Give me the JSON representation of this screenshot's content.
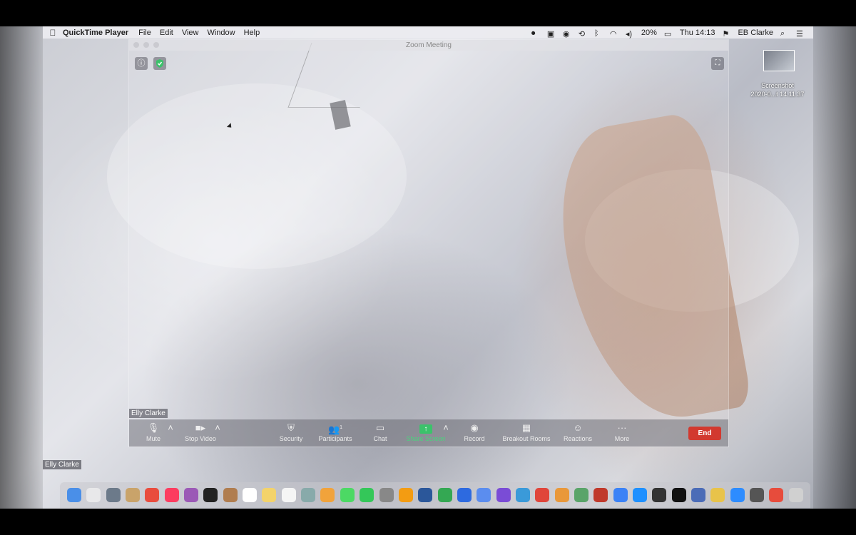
{
  "menubar": {
    "app_name": "QuickTime Player",
    "menus": [
      "File",
      "Edit",
      "View",
      "Window",
      "Help"
    ],
    "battery": "20%",
    "clock": "Thu 14:13",
    "user": "EB Clarke"
  },
  "zoom": {
    "window_title": "Zoom Meeting",
    "participant_name": "Elly Clarke",
    "participants_count": "1",
    "toolbar": {
      "mute": "Mute",
      "stop_video": "Stop Video",
      "security": "Security",
      "participants": "Participants",
      "chat": "Chat",
      "share_screen": "Share Screen",
      "record": "Record",
      "breakout_rooms": "Breakout Rooms",
      "reactions": "Reactions",
      "more": "More",
      "end": "End"
    }
  },
  "desktop": {
    "file_label_line1": "Screenshot",
    "file_label_line2": "2020-0...t 14.11.37",
    "bottom_name": "Elly Clarke"
  },
  "colors": {
    "end_button": "#d2392f",
    "share_green": "#4bd27e"
  },
  "dock_icons": [
    "finder",
    "safari",
    "launchpad",
    "notes",
    "chrome",
    "music",
    "podcasts",
    "tv",
    "contacts",
    "calendar",
    "stickies",
    "reminders",
    "photos-preview",
    "photos",
    "messages",
    "facetime",
    "scripts",
    "pages",
    "word",
    "numbers",
    "keynote",
    "finder2",
    "star",
    "lamp",
    "news",
    "books",
    "maps",
    "photo-booth",
    "safari2",
    "app-store",
    "obs",
    "vinyl",
    "earth",
    "notes2",
    "zoom",
    "alfred",
    "adobe",
    "trash"
  ]
}
